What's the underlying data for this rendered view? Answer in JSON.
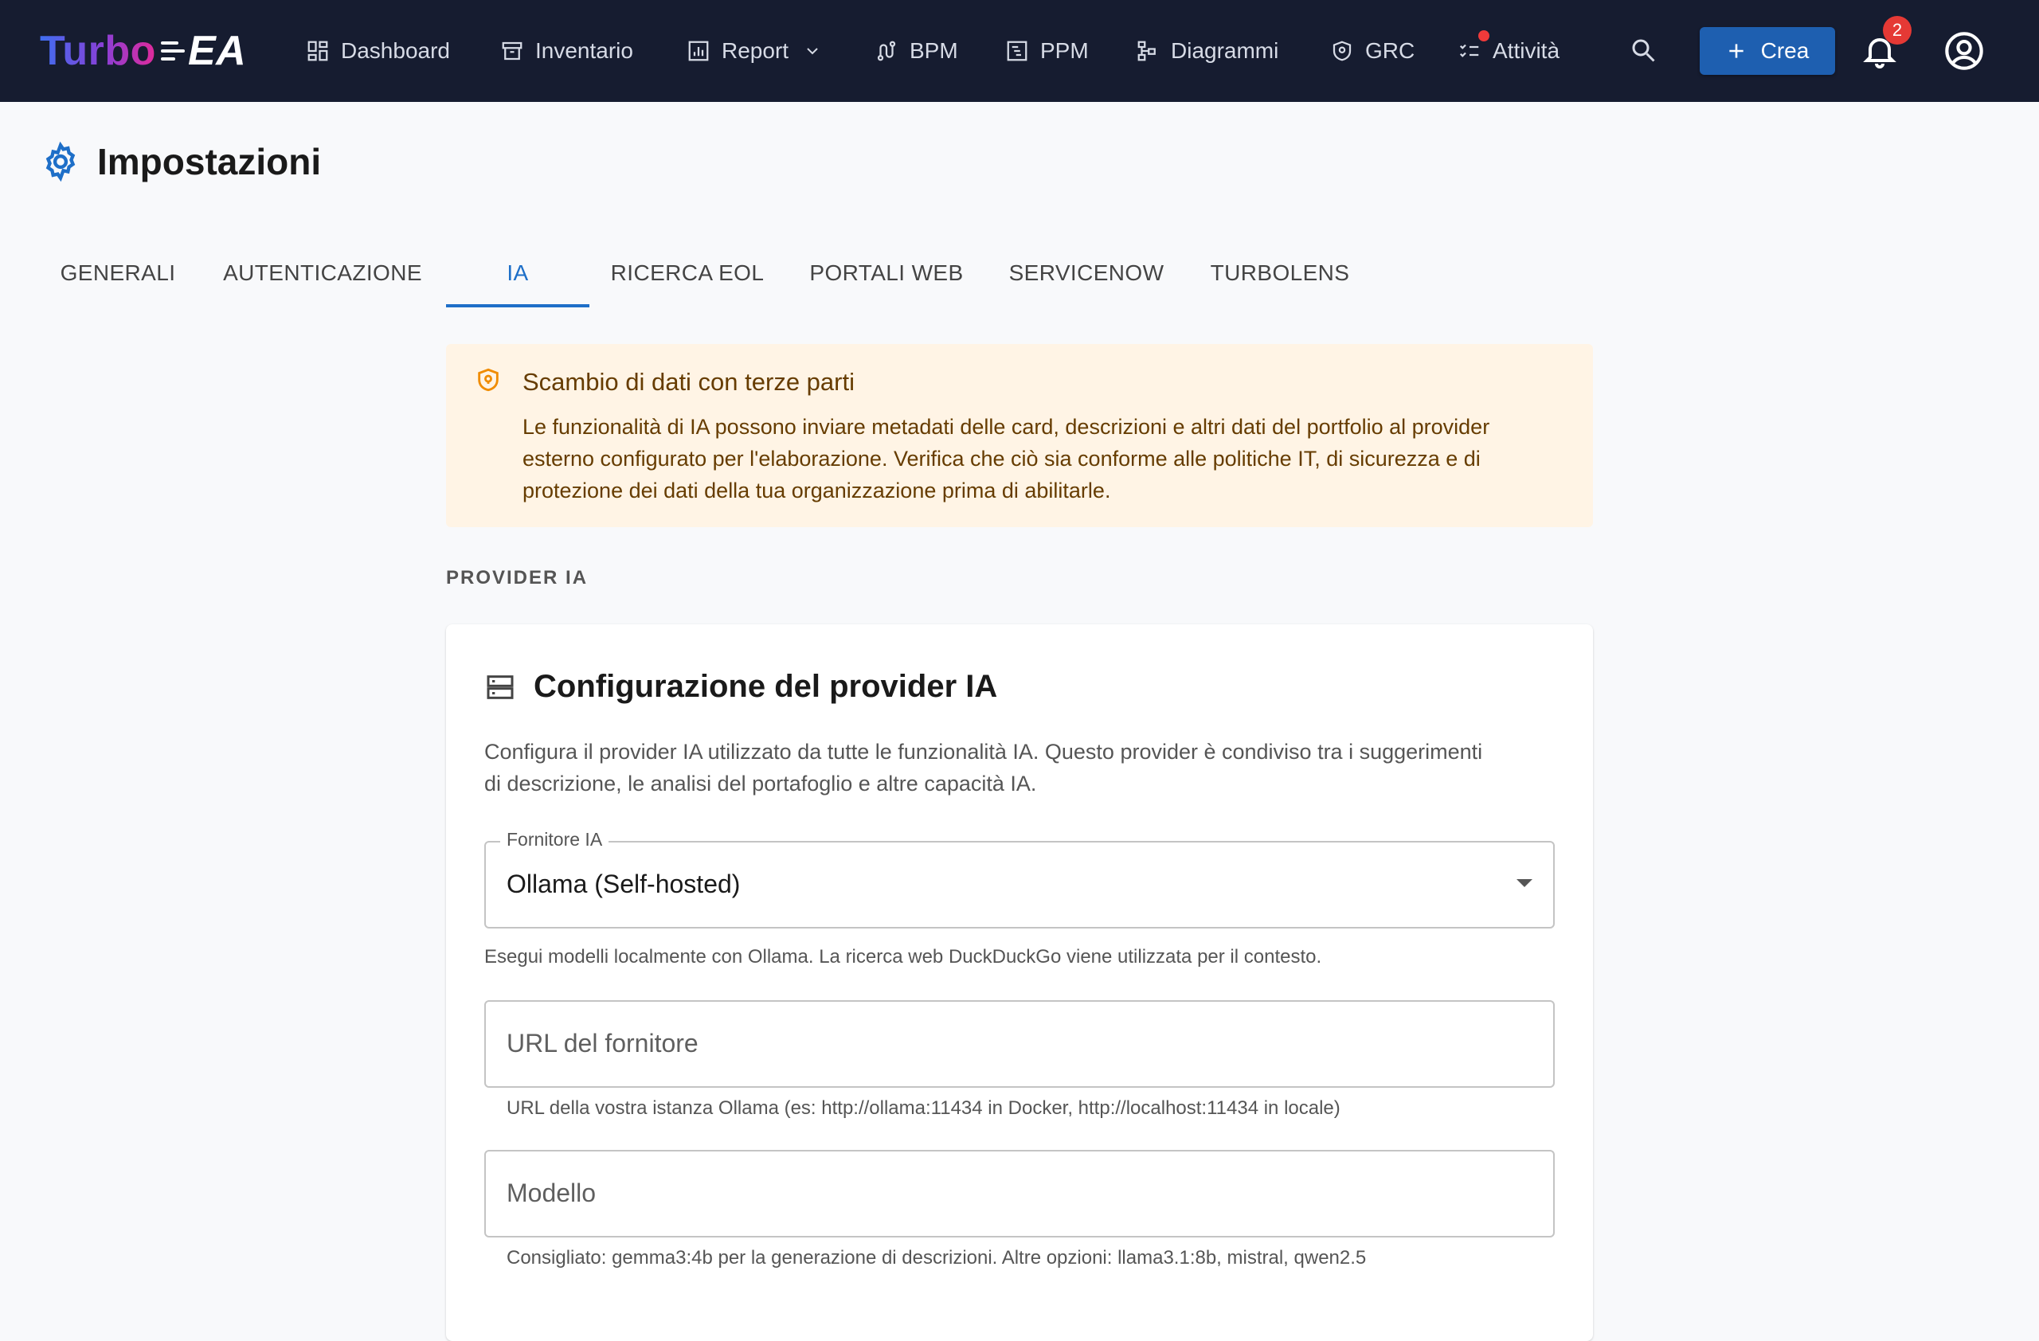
{
  "brand": {
    "part1": "Turbo",
    "part2": "EA"
  },
  "nav": {
    "items": [
      {
        "label": "Dashboard",
        "icon": "dashboard-icon"
      },
      {
        "label": "Inventario",
        "icon": "archive-icon"
      },
      {
        "label": "Report",
        "icon": "bar-chart-icon"
      },
      {
        "label": "BPM",
        "icon": "route-icon"
      },
      {
        "label": "PPM",
        "icon": "gantt-icon"
      },
      {
        "label": "Diagrammi",
        "icon": "diagram-icon"
      },
      {
        "label": "GRC",
        "icon": "shield-icon"
      },
      {
        "label": "Attività",
        "icon": "checklist-icon"
      }
    ],
    "create_label": "Crea",
    "notification_count": "2"
  },
  "page": {
    "title": "Impostazioni"
  },
  "tabs": [
    {
      "label": "GENERALI"
    },
    {
      "label": "AUTENTICAZIONE"
    },
    {
      "label": "IA",
      "active": true
    },
    {
      "label": "RICERCA EOL"
    },
    {
      "label": "PORTALI WEB"
    },
    {
      "label": "SERVICENOW"
    },
    {
      "label": "TURBOLENS"
    }
  ],
  "alert": {
    "title": "Scambio di dati con terze parti",
    "body": "Le funzionalità di IA possono inviare metadati delle card, descrizioni e altri dati del portfolio al provider esterno configurato per l'elaborazione. Verifica che ciò sia conforme alle politiche IT, di sicurezza e di protezione dei dati della tua organizzazione prima di abilitarle."
  },
  "section_label": "PROVIDER IA",
  "card": {
    "title": "Configurazione del provider IA",
    "description": "Configura il provider IA utilizzato da tutte le funzionalità IA. Questo provider è condiviso tra i suggerimenti di descrizione, le analisi del portafoglio e altre capacità IA.",
    "provider_select": {
      "label": "Fornitore IA",
      "value": "Ollama (Self-hosted)",
      "helper": "Esegui modelli localmente con Ollama. La ricerca web DuckDuckGo viene utilizzata per il contesto."
    },
    "url_field": {
      "placeholder": "URL del fornitore",
      "helper": "URL della vostra istanza Ollama (es: http://ollama:11434 in Docker, http://localhost:11434 in locale)"
    },
    "model_field": {
      "placeholder": "Modello",
      "helper": "Consigliato: gemma3:4b per la generazione di descrizioni. Altre opzioni: llama3.1:8b, mistral, qwen2.5"
    }
  },
  "colors": {
    "topbar": "#161c30",
    "accent": "#1e6fc8",
    "create_button": "#1e5fb0",
    "alert_bg": "#fff4e5",
    "alert_text": "#663c00",
    "badge": "#e53935"
  }
}
